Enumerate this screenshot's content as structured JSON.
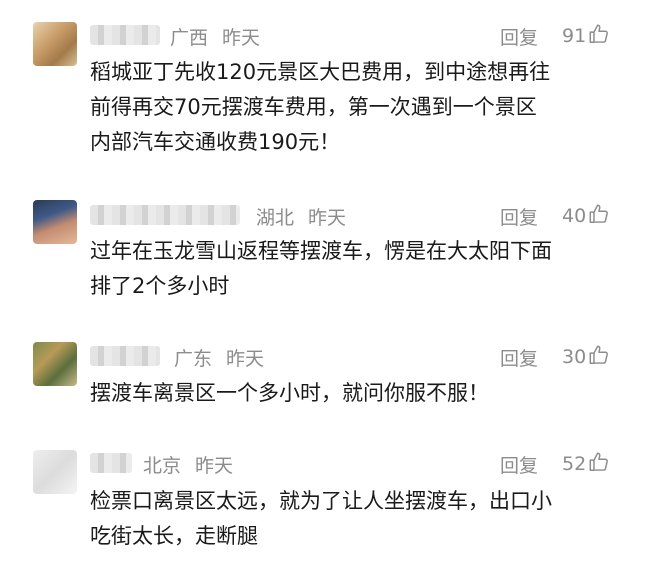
{
  "comments": [
    {
      "location": "广西",
      "time": "昨天",
      "reply": "回复",
      "likes": "91",
      "lines": [
        "稻城亚丁先收120元景区大巴费用，到中途想再往",
        "前得再交70元摆渡车费用，第一次遇到一个景区",
        "内部汽车交通收费190元！"
      ]
    },
    {
      "location": "湖北",
      "time": "昨天",
      "reply": "回复",
      "likes": "40",
      "lines": [
        "过年在玉龙雪山返程等摆渡车，愣是在大太阳下面",
        "排了2个多小时"
      ]
    },
    {
      "location": "广东",
      "time": "昨天",
      "reply": "回复",
      "likes": "30",
      "lines": [
        "摆渡车离景区一个多小时，就问你服不服！"
      ]
    },
    {
      "location": "北京",
      "time": "昨天",
      "reply": "回复",
      "likes": "52",
      "lines": [
        "检票口离景区太远，就为了让人坐摆渡车，出口小",
        "吃街太长，走断腿"
      ]
    }
  ]
}
